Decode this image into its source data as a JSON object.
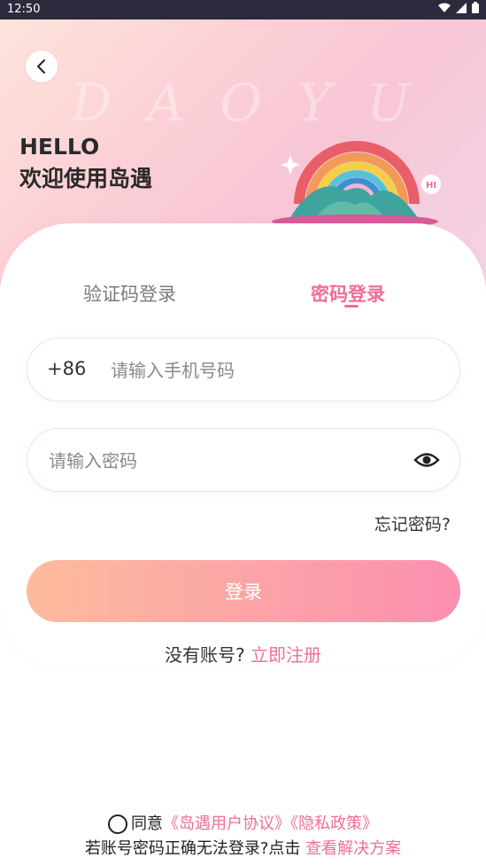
{
  "status_bar": {
    "time": "12:50",
    "icons": [
      "wifi-icon",
      "signal-icon",
      "battery-icon"
    ]
  },
  "header": {
    "back_icon": "chevron-left-icon",
    "watermark": "DAOYU",
    "greeting_line1": "HELLO",
    "greeting_line2": "欢迎使用岛遇",
    "illustration_badge": "HI"
  },
  "tabs": [
    {
      "label": "验证码登录",
      "active": false
    },
    {
      "label": "密码登录",
      "active": true
    }
  ],
  "phone": {
    "country_code": "+86",
    "placeholder": "请输入手机号码",
    "value": ""
  },
  "password": {
    "placeholder": "请输入密码",
    "value": "",
    "toggle_icon": "eye-icon"
  },
  "forgot_label": "忘记密码?",
  "login_label": "登录",
  "register": {
    "prompt": "没有账号?",
    "link": "立即注册"
  },
  "agreement": {
    "agree_text": "同意",
    "user_agreement": "《岛遇用户协议》",
    "privacy_policy": "《隐私政策》"
  },
  "help": {
    "text": "若账号密码正确无法登录?点击",
    "link": "查看解决方案"
  },
  "colors": {
    "accent": "#ef6f97",
    "button_start": "#fdbb9c",
    "button_end": "#fb8fb0",
    "status_bar": "#2b2b3d"
  }
}
